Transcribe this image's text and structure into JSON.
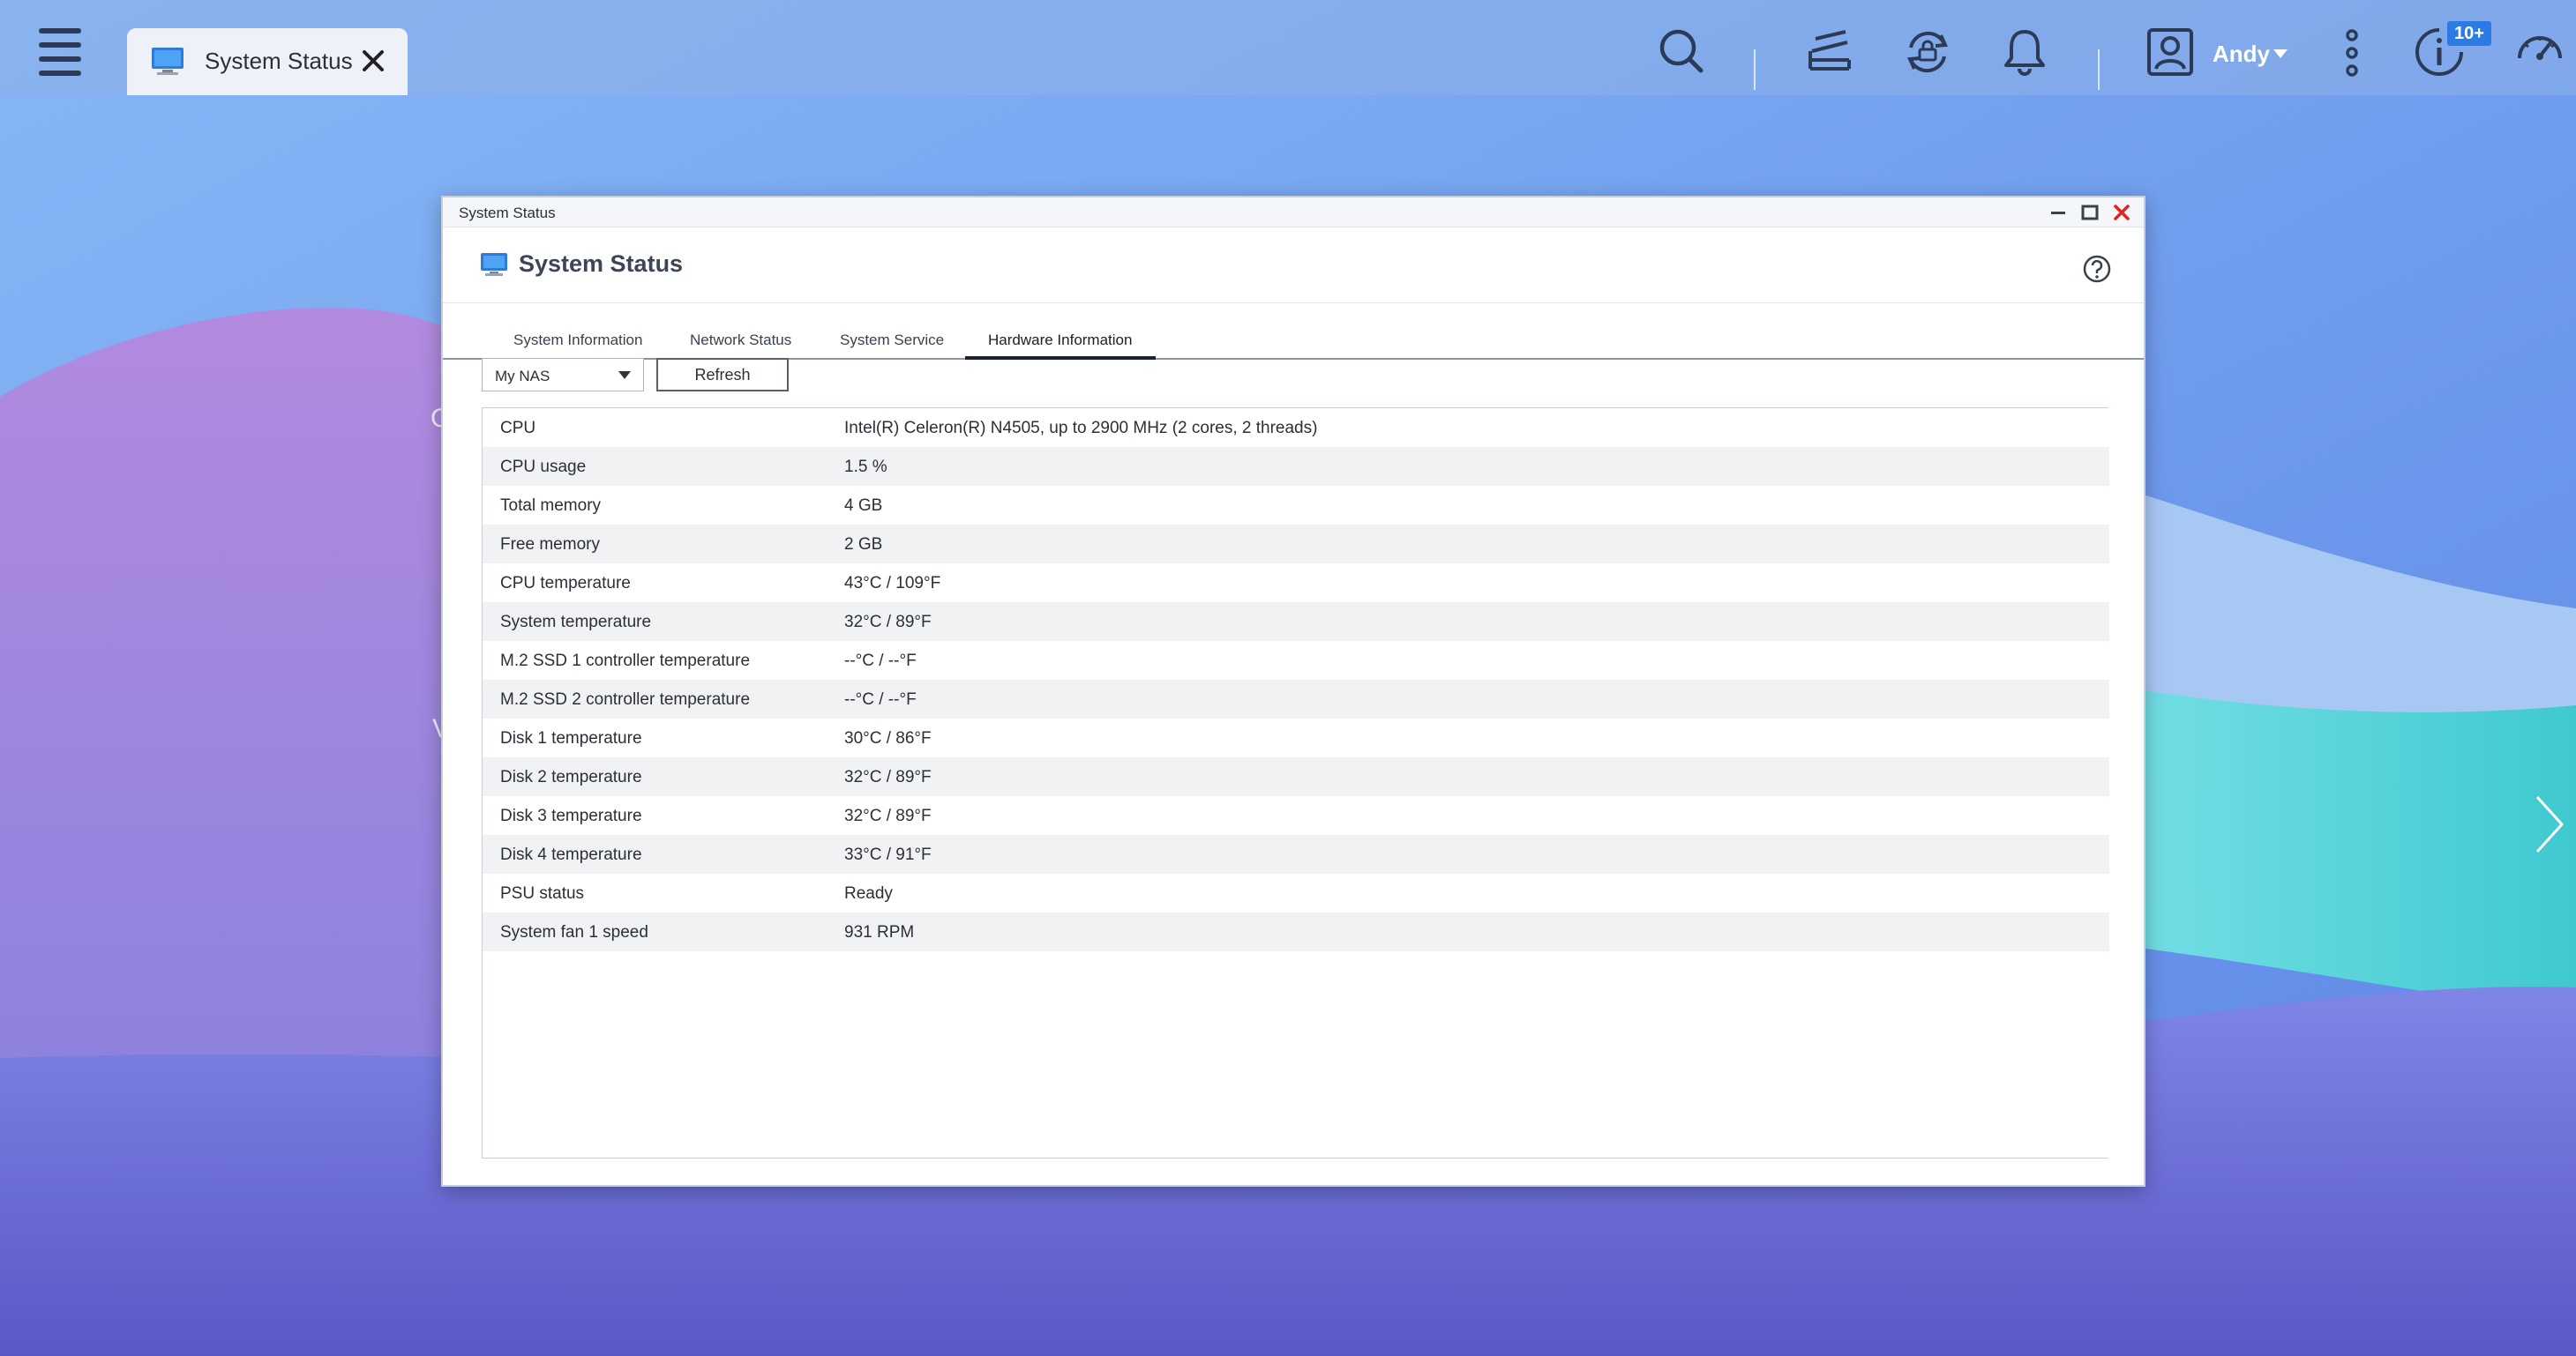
{
  "topbar": {
    "app_tab_label": "System Status",
    "user_name": "Andy",
    "notification_badge": "10+"
  },
  "window": {
    "title": "System Status",
    "header_title": "System Status"
  },
  "tabs": [
    {
      "label": "System Information",
      "active": false
    },
    {
      "label": "Network Status",
      "active": false
    },
    {
      "label": "System Service",
      "active": false
    },
    {
      "label": "Hardware Information",
      "active": true
    }
  ],
  "controls": {
    "device_selected": "My NAS",
    "refresh_label": "Refresh"
  },
  "hardware_rows": [
    {
      "label": "CPU",
      "value": "Intel(R) Celeron(R) N4505, up to 2900 MHz (2 cores, 2 threads)"
    },
    {
      "label": "CPU usage",
      "value": "1.5 %"
    },
    {
      "label": "Total memory",
      "value": "4 GB"
    },
    {
      "label": "Free memory",
      "value": "2 GB"
    },
    {
      "label": "CPU temperature",
      "value": "43°C / 109°F"
    },
    {
      "label": "System temperature",
      "value": "32°C / 89°F"
    },
    {
      "label": "M.2 SSD 1 controller temperature",
      "value": "--°C / --°F"
    },
    {
      "label": "M.2 SSD 2 controller temperature",
      "value": "--°C / --°F"
    },
    {
      "label": "Disk 1 temperature",
      "value": "30°C / 86°F"
    },
    {
      "label": "Disk 2 temperature",
      "value": "32°C / 89°F"
    },
    {
      "label": "Disk 3 temperature",
      "value": "32°C / 89°F"
    },
    {
      "label": "Disk 4 temperature",
      "value": "33°C / 91°F"
    },
    {
      "label": "PSU status",
      "value": "Ready"
    },
    {
      "label": "System fan 1 speed",
      "value": "931 RPM"
    }
  ],
  "background_peek": {
    "letter_1": "C",
    "letter_2": "V"
  },
  "icons": {
    "menu": "hamburger-menu-icon",
    "app": "monitor-icon",
    "search": "search-icon",
    "tasks": "background-tasks-icon",
    "sync": "sync-icon",
    "notifications": "bell-icon",
    "user": "user-icon",
    "more": "more-options-icon",
    "info": "system-info-icon",
    "dashboard": "dashboard-gauge-icon",
    "help": "help-icon"
  },
  "colors": {
    "accent": "#2c7be5",
    "close_red": "#e02424",
    "row_alt": "#f1f2f4"
  }
}
